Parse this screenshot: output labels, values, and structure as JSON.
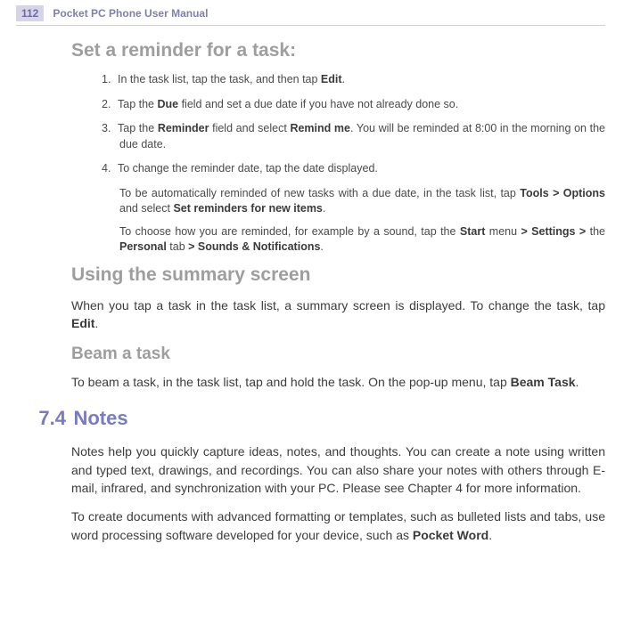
{
  "header": {
    "page_number": "112",
    "book_title": "Pocket PC Phone User Manual"
  },
  "sections": {
    "set_reminder": {
      "heading": "Set a reminder for a task:",
      "steps": [
        {
          "num": "1.",
          "html": "In the task list, tap the task, and then tap <b>Edit</b>."
        },
        {
          "num": "2.",
          "html": "Tap the <b>Due</b> field and set a due date if you have not already done so."
        },
        {
          "num": "3.",
          "html": "Tap the <b>Reminder</b> field and select <b>Remind me</b>. You will be reminded at 8:00 in the morning on the due date."
        },
        {
          "num": "4.",
          "html": "To change the reminder date, tap the date displayed."
        }
      ],
      "extras": [
        "To be automatically reminded of new tasks with a due date, in the task list, tap <b>Tools > Options</b> and select <b>Set reminders for new items</b>.",
        "To choose how you are reminded, for example by a sound, tap the <b>Start</b> menu <b>> Settings ></b> the <b>Personal</b> tab <b>> Sounds & Notifications</b>."
      ]
    },
    "summary_screen": {
      "heading": "Using the summary screen",
      "body": "When you tap a task in the task list, a summary screen is displayed. To change the task, tap <b>Edit</b>."
    },
    "beam_task": {
      "heading": "Beam a task",
      "body": "To beam a task, in the task list, tap and hold the task. On the pop-up menu, tap <b>Beam Task</b>."
    },
    "notes": {
      "section_num": "7.4",
      "section_word": "Notes",
      "body1": "Notes help you quickly capture ideas, notes, and thoughts. You can create a note using written and typed text, drawings, and recordings. You can also share your notes with others through E-mail, infrared, and synchronization with your PC. Please see Chapter 4 for more information.",
      "body2": "To create documents with advanced formatting or templates, such as bulleted lists and tabs, use word processing software developed for your device, such as <b>Pocket Word</b>."
    }
  }
}
